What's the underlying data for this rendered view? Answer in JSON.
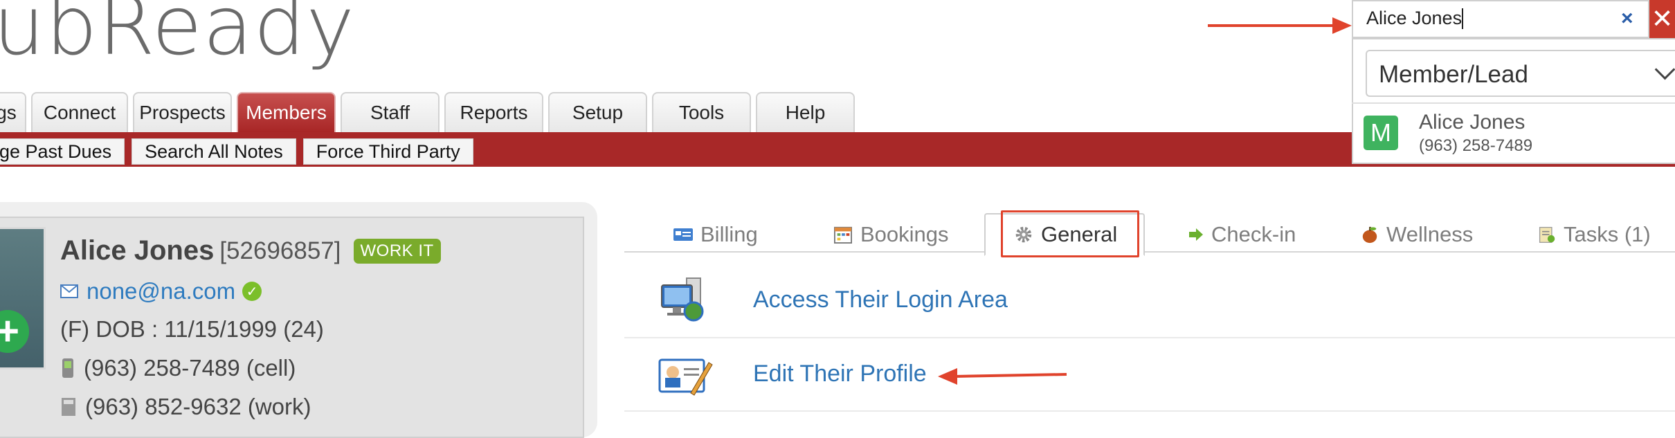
{
  "logo": {
    "text": "ubReady"
  },
  "main_nav": {
    "tabs": [
      "gs",
      "Connect",
      "Prospects",
      "Members",
      "Staff",
      "Reports",
      "Setup",
      "Tools",
      "Help"
    ],
    "active": "Members"
  },
  "sub_nav": {
    "items": [
      "ge Past Dues",
      "Search All Notes",
      "Force Third Party"
    ]
  },
  "search": {
    "value": "Alice Jones",
    "clear_icon": "×",
    "close_icon": "✕",
    "type_select": "Member/Lead",
    "result": {
      "avatar_letter": "M",
      "name": "Alice Jones",
      "phone": "(963) 258-7489"
    }
  },
  "member": {
    "name": "Alice Jones",
    "id": "[52696857]",
    "badge": "WORK IT",
    "email": "none@na.com",
    "dob": "(F) DOB : 11/15/1999 (24)",
    "cell": "(963) 258-7489 (cell)",
    "work": "(963) 852-9632 (work)",
    "add_icon": "+"
  },
  "profile_tabs": {
    "billing": "Billing",
    "bookings": "Bookings",
    "general": "General",
    "checkin": "Check-in",
    "wellness": "Wellness",
    "tasks": "Tasks (1)",
    "active": "General"
  },
  "general_actions": {
    "login_area": "Access Their Login Area",
    "edit_profile": "Edit Their Profile"
  },
  "colors": {
    "brand_red": "#a82828",
    "link_blue": "#2e74b5",
    "annotation_red": "#e0432c",
    "badge_green": "#7aab2b"
  }
}
